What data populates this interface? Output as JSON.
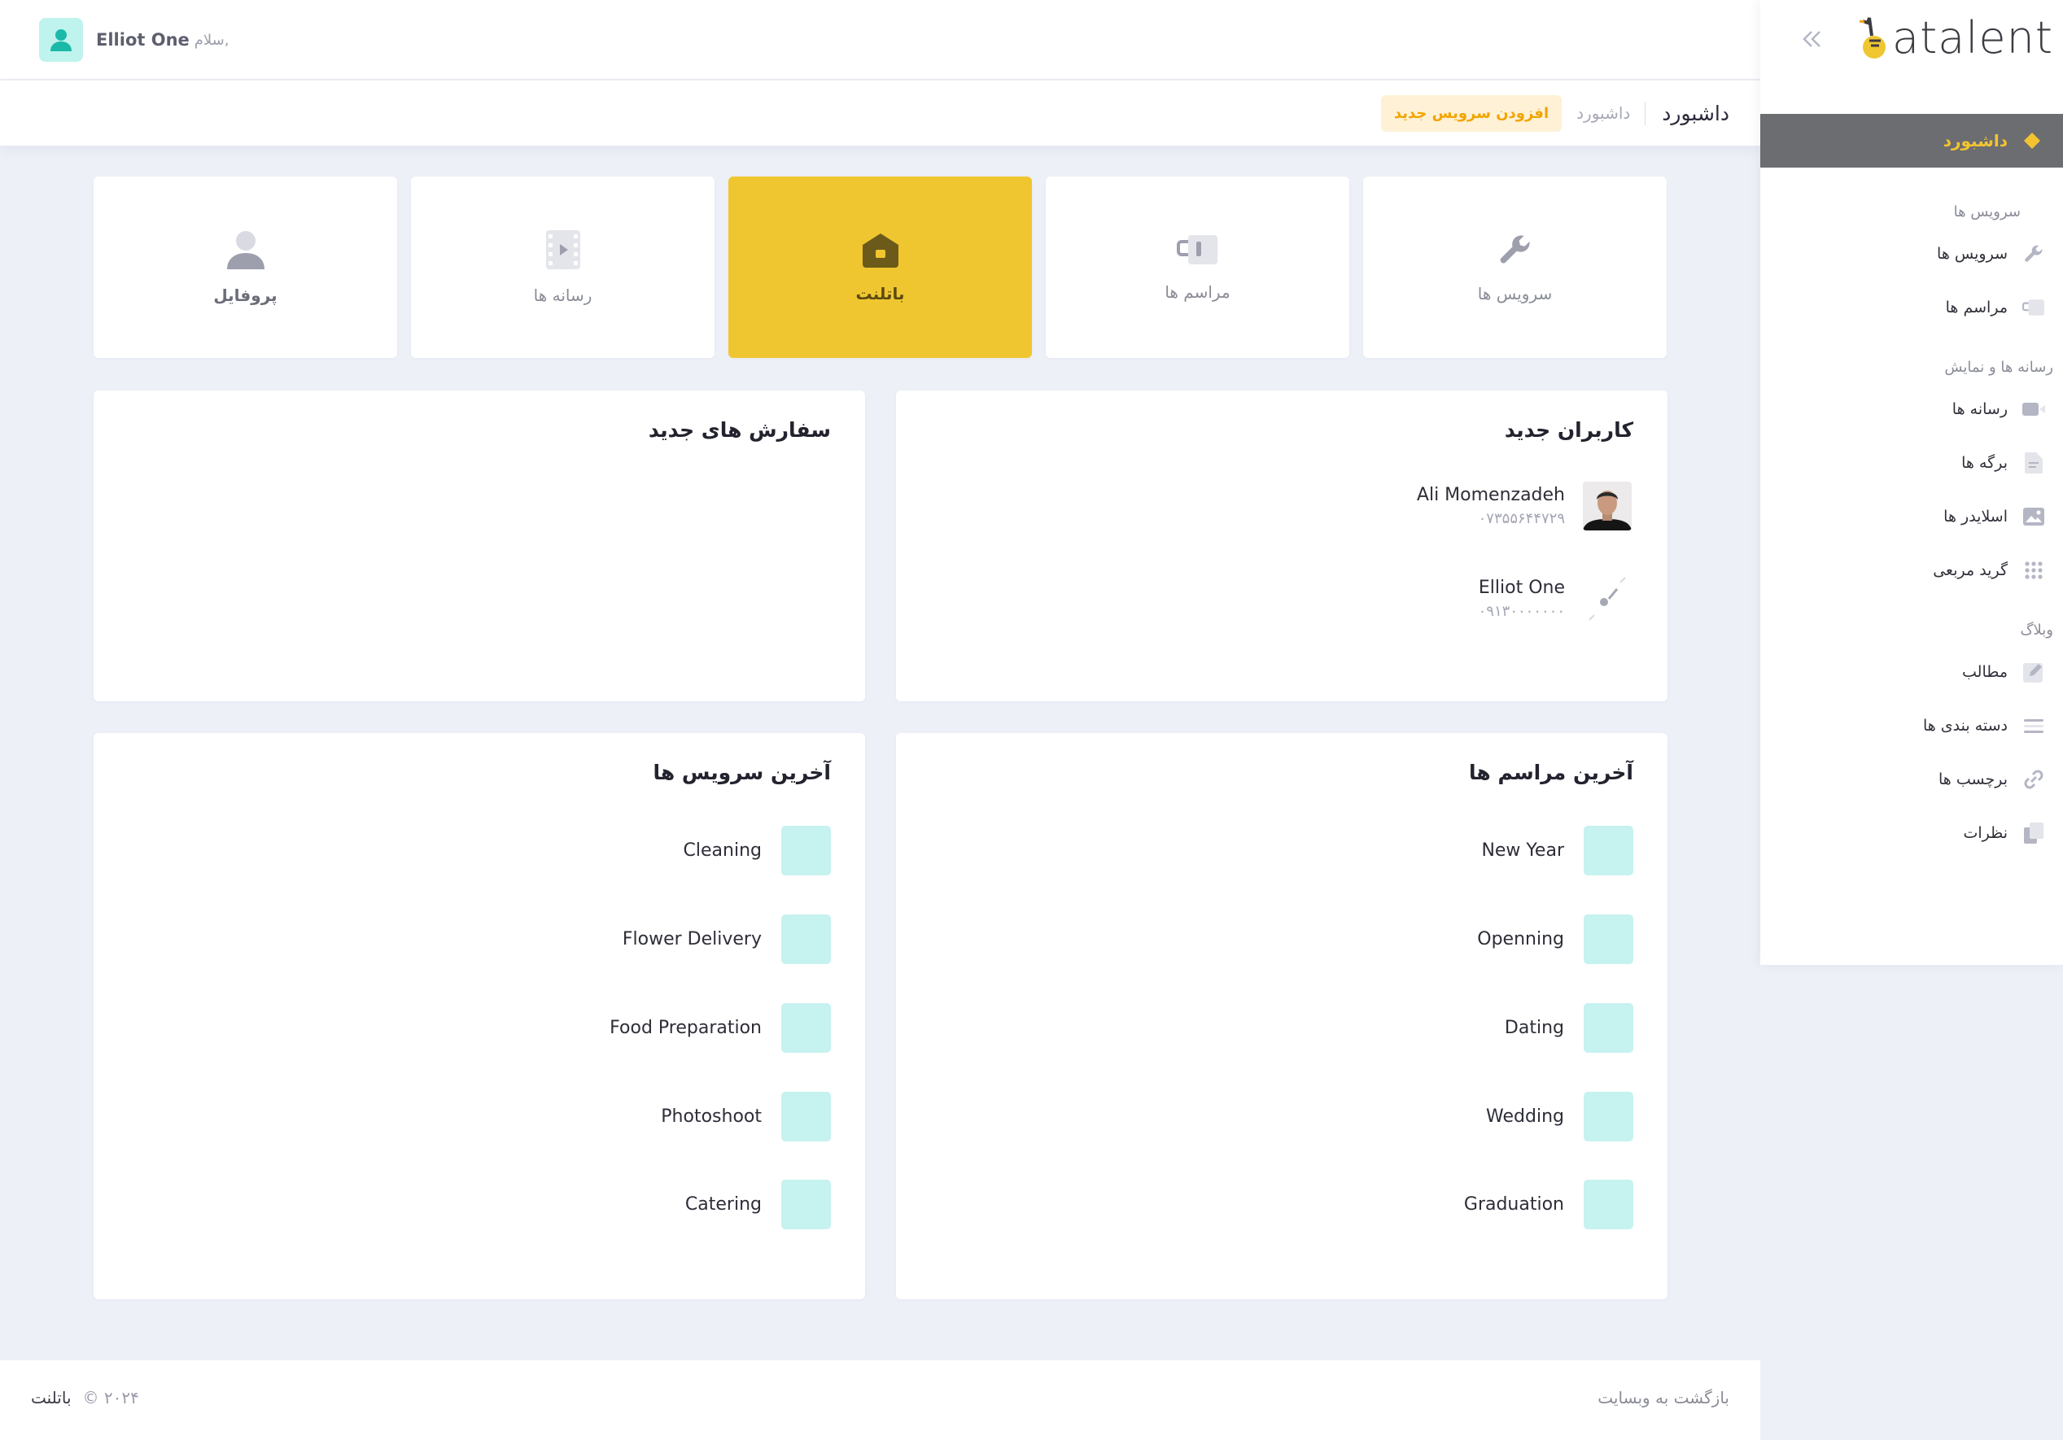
{
  "brand": {
    "name": "atalent"
  },
  "user": {
    "greeting": "سلام,",
    "name": "Elliot One"
  },
  "header": {
    "title": "داشبورد",
    "breadcrumb": "داشبورد",
    "add_service_label": "افزودن سرویس جدید"
  },
  "sidebar": {
    "active": {
      "label": "داشبورد",
      "icon": "diamond-icon"
    },
    "sections": [
      {
        "title": "سرویس ها",
        "items": [
          {
            "label": "سرویس ها",
            "icon": "wrench-icon"
          },
          {
            "label": "مراسم ها",
            "icon": "mug-icon"
          }
        ]
      },
      {
        "title": "رسانه ها و نمایش",
        "items": [
          {
            "label": "رسانه ها",
            "icon": "video-icon"
          },
          {
            "label": "برگه ها",
            "icon": "page-icon"
          },
          {
            "label": "اسلایدر ها",
            "icon": "image-icon"
          },
          {
            "label": "گرید مربعی",
            "icon": "grid-icon"
          }
        ]
      },
      {
        "title": "وبلاگ",
        "items": [
          {
            "label": "مطالب",
            "icon": "edit-icon"
          },
          {
            "label": "دسته بندی ها",
            "icon": "list-icon"
          },
          {
            "label": "برچسب ها",
            "icon": "link-icon"
          },
          {
            "label": "نظرات",
            "icon": "copy-icon"
          }
        ]
      }
    ]
  },
  "tiles": [
    {
      "label": "سرویس ها",
      "icon": "wrench-icon"
    },
    {
      "label": "مراسم ها",
      "icon": "mug-icon"
    },
    {
      "label": "باتلنت",
      "icon": "home-icon"
    },
    {
      "label": "رسانه ها",
      "icon": "film-icon"
    },
    {
      "label": "پروفایل",
      "icon": "user-icon"
    }
  ],
  "new_users": {
    "title": "کاربران جدید",
    "items": [
      {
        "name": "Ali Momenzadeh",
        "phone": "۰۷۳۵۵۶۴۴۷۲۹"
      },
      {
        "name": "Elliot One",
        "phone": "۰۹۱۳۰۰۰۰۰۰۰"
      }
    ]
  },
  "new_orders": {
    "title": "سفارش های جدید"
  },
  "latest_events": {
    "title": "آخرین مراسم ها",
    "items": [
      "New Year",
      "Openning",
      "Dating",
      "Wedding",
      "Graduation"
    ]
  },
  "latest_services": {
    "title": "آخرین سرویس ها",
    "items": [
      "Cleaning",
      "Flower Delivery",
      "Food Preparation",
      "Photoshoot",
      "Catering"
    ]
  },
  "footer": {
    "brand": "باتلنت",
    "copyright": "© ۲۰۲۴",
    "back_link": "بازگشت به وبسایت"
  },
  "colors": {
    "accent": "#f0c630",
    "sidebar_active_bg": "#6c6d70",
    "thumb": "#c6f2f0",
    "avatar_bg": "#bff3ee"
  }
}
